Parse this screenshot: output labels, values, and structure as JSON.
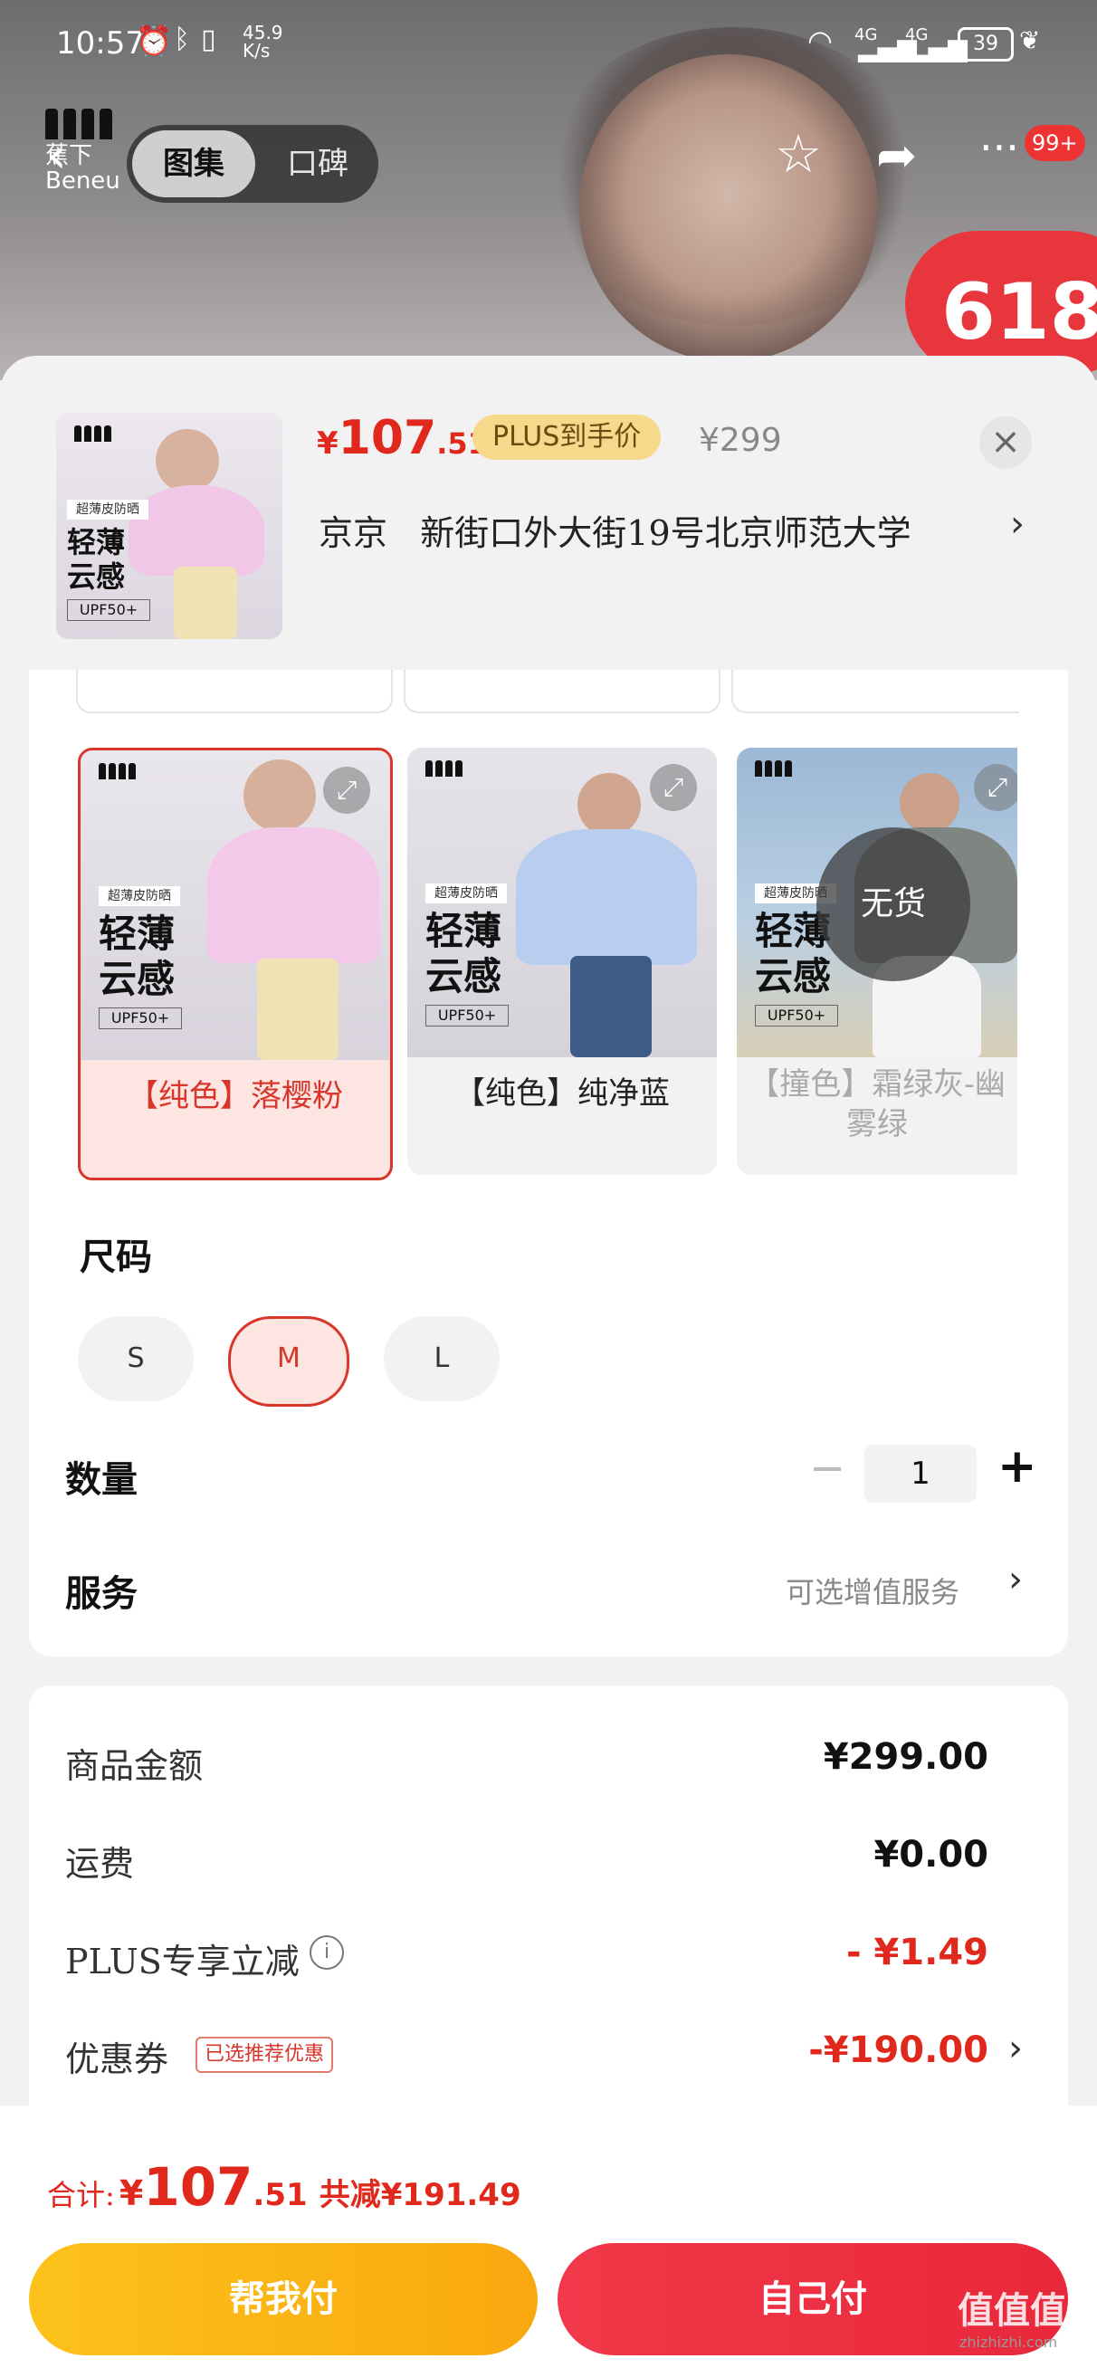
{
  "status_bar": {
    "time": "10:57",
    "net_speed_top": "45.9",
    "net_speed_unit": "K/s",
    "signal1": "4G",
    "signal2": "4G",
    "battery": "39"
  },
  "header": {
    "brand_line1": "蕉下",
    "brand_line2": "Beneu",
    "tabs": [
      "图集",
      "口碑"
    ],
    "active_tab": "图集",
    "badge": "99+",
    "promo_badge": "618"
  },
  "summary": {
    "currency": "¥",
    "price_int": "107",
    "price_dec": ".51",
    "plus_label": "PLUS到手价",
    "original_price": "¥299",
    "address_prefix": "京京",
    "address": "新街口外大街19号北京师范大学",
    "thumb_text1": "轻薄",
    "thumb_text2": "云感",
    "thumb_tag": "超薄皮防晒",
    "thumb_upf": "UPF50+"
  },
  "colors": {
    "options": [
      {
        "label": "【纯色】落樱粉",
        "selected": true,
        "available": true,
        "title1": "轻薄",
        "title2": "云感",
        "tag": "超薄皮防晒",
        "upf": "UPF50+",
        "brand": "Beneunder"
      },
      {
        "label": "【纯色】纯净蓝",
        "selected": false,
        "available": true,
        "title1": "轻薄",
        "title2": "云感",
        "tag": "超薄皮防晒",
        "upf": "UPF50+",
        "brand": "Beneunder"
      },
      {
        "label": "【撞色】霜绿灰-幽雾绿",
        "selected": false,
        "available": false,
        "title1": "轻薄",
        "title2": "云感",
        "tag": "超薄皮防晒",
        "upf": "UPF50+",
        "brand": "Beneunder"
      }
    ],
    "no_stock_label": "无货"
  },
  "size": {
    "title": "尺码",
    "options": [
      "S",
      "M",
      "L"
    ],
    "selected": "M"
  },
  "quantity": {
    "title": "数量",
    "value": "1",
    "minus": "−",
    "plus": "+"
  },
  "service": {
    "title": "服务",
    "value": "可选增值服务"
  },
  "price_detail": {
    "rows": [
      {
        "label": "商品金额",
        "value": "¥299.00"
      },
      {
        "label": "运费",
        "value": "¥0.00"
      },
      {
        "label": "PLUS专享立减",
        "value": "- ¥1.49"
      },
      {
        "label": "优惠券",
        "value": "-¥190.00",
        "tag": "已选推荐优惠"
      }
    ]
  },
  "footer": {
    "total_label": "合计:",
    "currency": "¥",
    "total_int": "107",
    "total_dec": ".51",
    "saving": "共减¥191.49",
    "help_pay": "帮我付",
    "self_pay": "自己付",
    "watermark": "值值值",
    "watermark_url": "zhizhizhi.com"
  },
  "theme": {
    "accent_red": "#e0281c",
    "plus_gold": "#f6d98a",
    "help_pay_color": "#fbb515",
    "self_pay_color": "#ef3242"
  }
}
